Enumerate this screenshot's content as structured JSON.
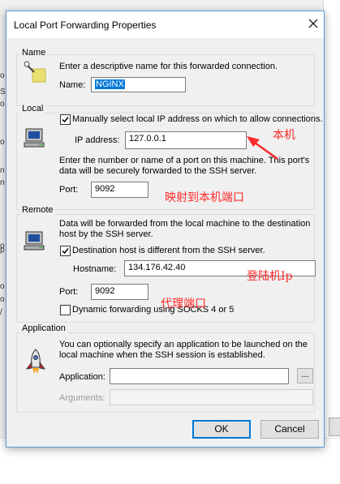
{
  "window_title": "Local Port Forwarding Properties",
  "name_section": {
    "label": "Name",
    "description": "Enter a descriptive name for this forwarded connection.",
    "name_label": "Name:",
    "name_value": "NGINX"
  },
  "local_section": {
    "label": "Local",
    "manual_ip_checkbox_label": "Manually select local IP address on which to allow connections.",
    "manual_ip_checked": true,
    "ip_label": "IP address:",
    "ip_value": "127.0.0.1",
    "port_help_line1": "Enter the number or name of a port on this machine.  This port's",
    "port_help_line2": "data will be securely forwarded to the SSH server.",
    "port_label": "Port:",
    "port_value": "9092"
  },
  "remote_section": {
    "label": "Remote",
    "help_line1": "Data will be forwarded from the local machine to the destination",
    "help_line2": "host by the SSH server.",
    "dest_checkbox_label": "Destination host is different from the SSH server.",
    "dest_checked": true,
    "hostname_label": "Hostname:",
    "hostname_value": "134.176.42.40",
    "port_label": "Port:",
    "port_value": "9092",
    "dynamic_checkbox_label": "Dynamic forwarding using SOCKS 4 or 5",
    "dynamic_checked": false
  },
  "application_section": {
    "label": "Application",
    "help_line1": "You can optionally specify an application to be launched on the",
    "help_line2": "local machine when the SSH session is established.",
    "application_label": "Application:",
    "application_value": "",
    "browse_label": "...",
    "arguments_label": "Arguments:",
    "arguments_value": ""
  },
  "buttons": {
    "ok": "OK",
    "cancel": "Cancel"
  },
  "annotations": {
    "local_machine": "本机",
    "map_to_local_port": "映射到本机端口",
    "login_machine_ip": "登陆机Ip",
    "proxy_port": "代理端口"
  },
  "colors": {
    "annotation": "#ff2a2a",
    "selection": "#0078d7",
    "dialog_border": "#5b9bd5"
  },
  "background": {
    "left_letters": [
      "o",
      "S",
      "o",
      "o",
      "n",
      "n",
      "o",
      "p",
      "o",
      "o",
      "/"
    ]
  }
}
